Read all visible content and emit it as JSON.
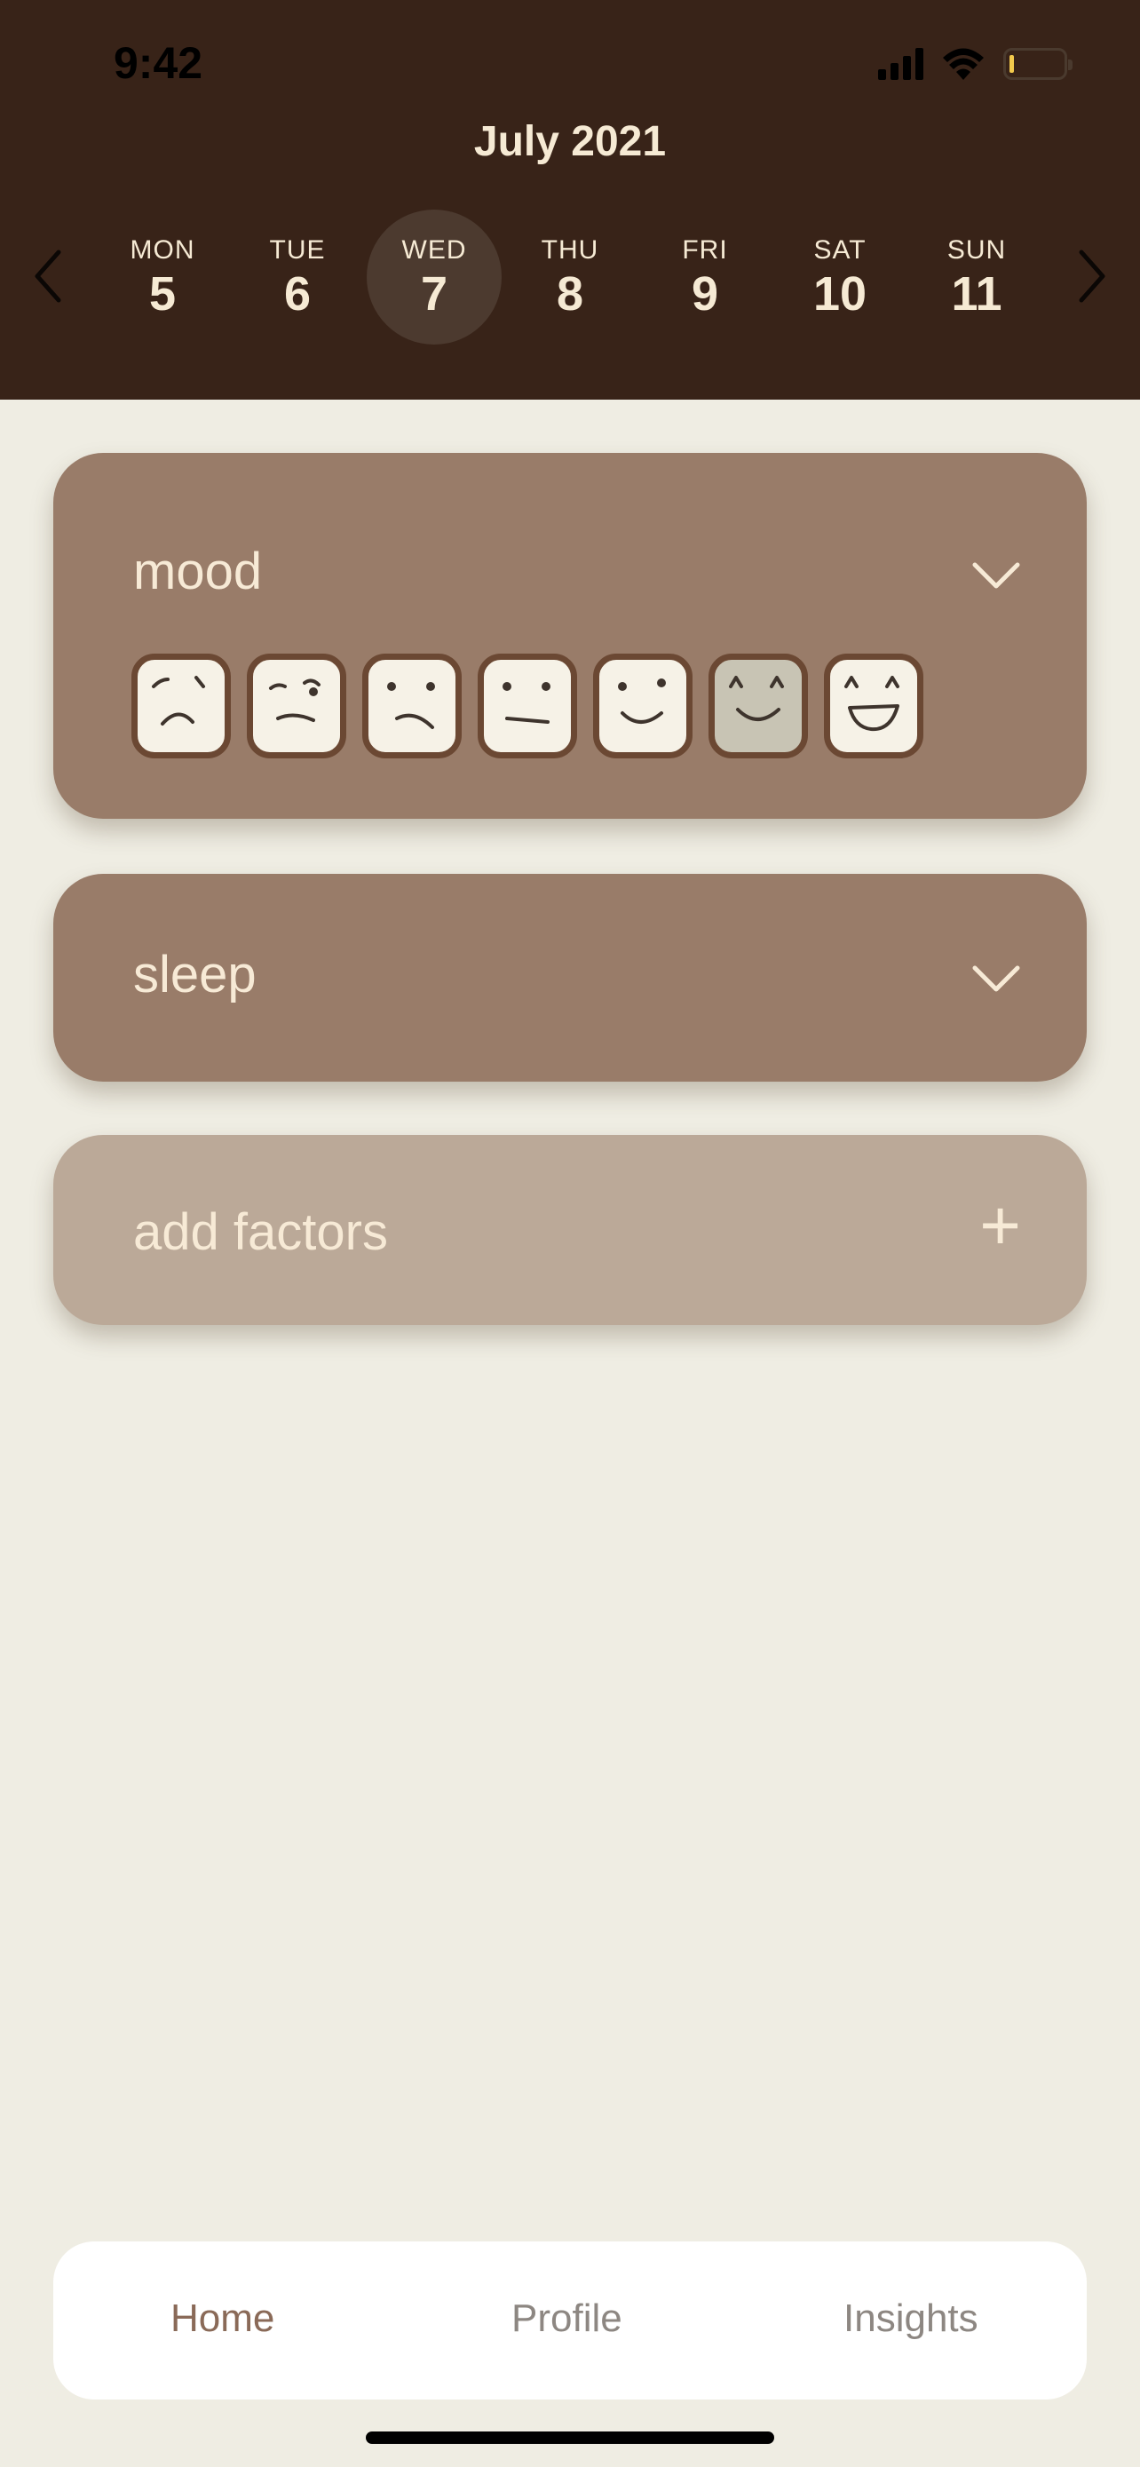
{
  "status_bar": {
    "time": "9:42",
    "icons": [
      "cellular-signal-icon",
      "wifi-icon",
      "battery-low-icon"
    ],
    "battery_level": 0.05
  },
  "header": {
    "month": "July 2021",
    "days": [
      {
        "name": "MON",
        "num": "5"
      },
      {
        "name": "TUE",
        "num": "6"
      },
      {
        "name": "WED",
        "num": "7",
        "selected": true
      },
      {
        "name": "THU",
        "num": "8"
      },
      {
        "name": "FRI",
        "num": "9"
      },
      {
        "name": "SAT",
        "num": "10"
      },
      {
        "name": "SUN",
        "num": "11"
      }
    ],
    "prev_icon": "chevron-left-icon",
    "next_icon": "chevron-right-icon"
  },
  "cards": {
    "mood": {
      "title": "mood",
      "icon": "chevron-down-icon",
      "faces": [
        "very-sad-face-icon",
        "worried-face-icon",
        "unhappy-face-icon",
        "neutral-face-icon",
        "slightly-happy-face-icon",
        "content-face-icon",
        "very-happy-face-icon"
      ],
      "selected_index": 5
    },
    "sleep": {
      "title": "sleep",
      "icon": "chevron-down-icon"
    },
    "add": {
      "title": "add factors",
      "icon": "plus-icon",
      "symbol": "+"
    }
  },
  "tabbar": {
    "items": [
      {
        "label": "Home",
        "active": true
      },
      {
        "label": "Profile"
      },
      {
        "label": "Insights"
      }
    ]
  },
  "colors": {
    "header_bg": "#382318",
    "page_bg": "#efede3",
    "card_bg": "#997c69",
    "add_card_bg": "#bba998",
    "accent_text": "#f6ead4",
    "face_border": "#6b4833"
  }
}
